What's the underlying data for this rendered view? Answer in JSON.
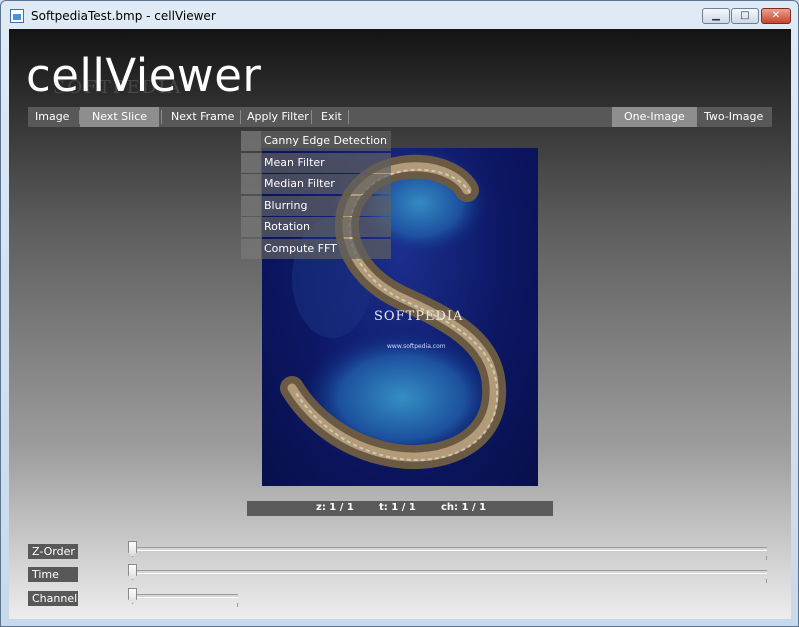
{
  "window": {
    "title": "SoftpediaTest.bmp - cellViewer"
  },
  "app": {
    "title": "cellViewer",
    "watermark": "SOFTPEDIA",
    "watermark_url": "www.softpedia.com"
  },
  "menu": {
    "image": "Image",
    "next_slice": "Next Slice",
    "next_frame": "Next Frame",
    "apply_filter": "Apply Filter",
    "exit": "Exit",
    "one_image": "One-Image",
    "two_image": "Two-Image"
  },
  "filters": [
    "Canny Edge Detection",
    "Mean Filter",
    "Median Filter",
    "Blurring",
    "Rotation",
    "Compute FFT"
  ],
  "viewer": {
    "image_watermark": "SOFTPEDIA",
    "image_url": "www.softpedia.com"
  },
  "status": {
    "z": "z: 1 / 1",
    "t": "t: 1 / 1",
    "ch": "ch: 1 / 1"
  },
  "sliders": {
    "z_label": "Z-Order",
    "time_label": "Time",
    "channel_label": "Channel"
  },
  "colors": {
    "menu_bg": "#585858",
    "menu_highlight": "#8e8e8e",
    "close_button": "#c8432b",
    "image_bg": "#0c1763"
  }
}
